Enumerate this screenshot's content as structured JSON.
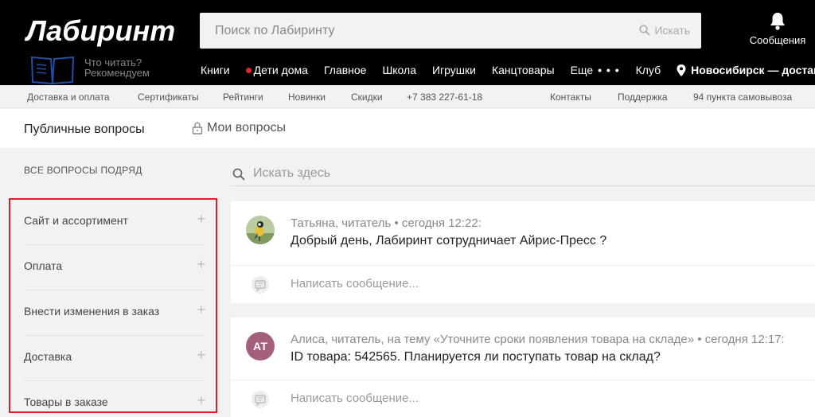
{
  "header": {
    "logo": "Лабиринт",
    "search_placeholder": "Поиск по Лабиринту",
    "search_button": "Искать",
    "messages_label": "Сообщения",
    "recommend_line1": "Что читать?",
    "recommend_line2": "Рекомендуем",
    "nav": [
      {
        "label": "Книги"
      },
      {
        "label": "Дети дома"
      },
      {
        "label": "Главное"
      },
      {
        "label": "Школа"
      },
      {
        "label": "Игрушки"
      },
      {
        "label": "Канцтовары"
      },
      {
        "label": "Еще"
      },
      {
        "label": "Клуб"
      }
    ],
    "more_dots": "• • •",
    "city": "Новосибирск — доставка"
  },
  "subnav": {
    "items": [
      "Доставка и оплата",
      "Сертификаты",
      "Рейтинги",
      "Новинки",
      "Скидки",
      "+7 383 227-61-18",
      "Контакты",
      "Поддержка",
      "94 пункта самовывоза"
    ]
  },
  "tabs": {
    "public": "Публичные вопросы",
    "mine": "Мои вопросы"
  },
  "sidebar": {
    "all_questions": "ВСЕ ВОПРОСЫ ПОДРЯД",
    "categories": [
      {
        "label": "Сайт и ассортимент"
      },
      {
        "label": "Оплата"
      },
      {
        "label": "Внести изменения в заказ"
      },
      {
        "label": "Доставка"
      },
      {
        "label": "Товары в заказе"
      }
    ],
    "plus": "+"
  },
  "main": {
    "search_placeholder": "Искать здесь",
    "questions": [
      {
        "meta": "Татьяна, читатель • сегодня 12:22:",
        "text": "Добрый день, Лабиринт сотрудничает Айрис-Пресс ?",
        "reply_placeholder": "Написать сообщение..."
      },
      {
        "avatar_initials": "АТ",
        "meta": "Алиса, читатель, на тему «Уточните сроки появления товара на складе» • сегодня 12:17:",
        "text": "ID товара: 542565. Планируется ли поступать товар на склад?",
        "reply_placeholder": "Написать сообщение..."
      }
    ]
  },
  "colors": {
    "header_bg": "#000000",
    "highlight_border": "#e31e24",
    "dot_red": "#e8202a",
    "avatar_at": "#a45f7c"
  }
}
